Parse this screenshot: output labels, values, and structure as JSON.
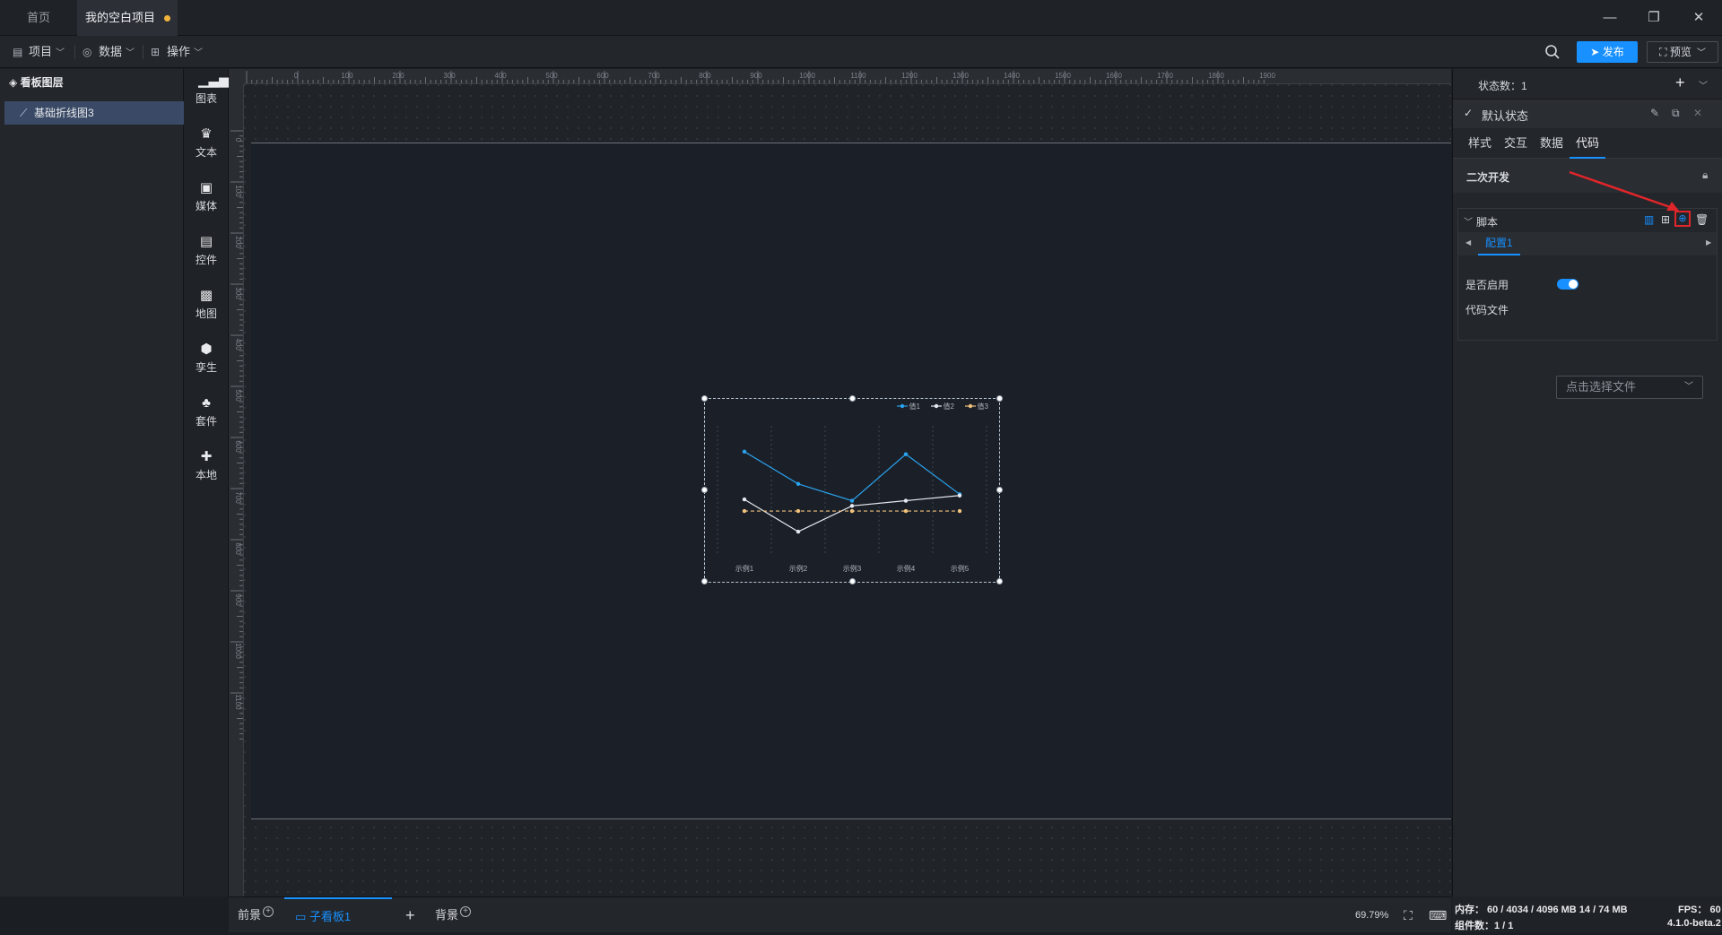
{
  "titlebar": {
    "tab_home": "首页",
    "tab_project": "我的空白项目",
    "minimize": "—",
    "restore": "❐",
    "close": "✕"
  },
  "menubar": {
    "project": "项目",
    "data": "数据",
    "operate": "操作",
    "publish": "发布",
    "preview": "预览"
  },
  "layers": {
    "title": "看板图层",
    "items": [
      "基础折线图3"
    ]
  },
  "components": [
    "图表",
    "文本",
    "媒体",
    "控件",
    "地图",
    "孪生",
    "套件",
    "本地"
  ],
  "ruler": {
    "top_ticks": [
      "0",
      "100",
      "200",
      "300",
      "400",
      "500",
      "600",
      "700",
      "800",
      "900",
      "1000",
      "1100",
      "1200",
      "1300",
      "1400",
      "1500",
      "1600",
      "1700",
      "1800",
      "1900"
    ],
    "left_ticks": [
      "0",
      "100",
      "200",
      "300",
      "400",
      "500",
      "600",
      "700",
      "800",
      "900",
      "1000",
      "1100"
    ]
  },
  "chart_data": {
    "type": "line",
    "categories": [
      "示例1",
      "示例2",
      "示例3",
      "示例4",
      "示例5"
    ],
    "series": [
      {
        "name": "值1",
        "values": [
          80,
          55,
          42,
          78,
          47
        ],
        "color": "#2aa3f0"
      },
      {
        "name": "值2",
        "values": [
          43,
          18,
          38,
          42,
          46
        ],
        "color": "#e6e9ef"
      },
      {
        "name": "值3",
        "values": [
          34,
          34,
          34,
          34,
          34
        ],
        "color": "#f1c27d",
        "dashed": true
      }
    ],
    "ylim": [
      0,
      100
    ],
    "legend": "top-right",
    "grid": "vertical-dashed"
  },
  "bottombar": {
    "foreground": "前景",
    "sub_board": "子看板1",
    "add": "+",
    "background": "背景",
    "zoom": "69.79%"
  },
  "right_panel": {
    "state_count": "状态数：1",
    "default_state": "默认状态",
    "tabs": [
      "样式",
      "交互",
      "数据",
      "代码"
    ],
    "active_tab": "代码",
    "secondary_dev": "二次开发",
    "script": "脚本",
    "config_tab": "配置1",
    "enabled_label": "是否启用",
    "enabled": true,
    "code_file_label": "代码文件",
    "code_file_placeholder": "点击选择文件"
  },
  "statusbar": {
    "memory": "内存： 60 / 4034 / 4096 MB 14 / 74 MB",
    "fps": "FPS：  60",
    "component_count": "组件数：1 / 1",
    "version": "4.1.0-beta.2"
  },
  "colors": {
    "accent": "#1890ff",
    "highlight_box": "#e0262a"
  }
}
